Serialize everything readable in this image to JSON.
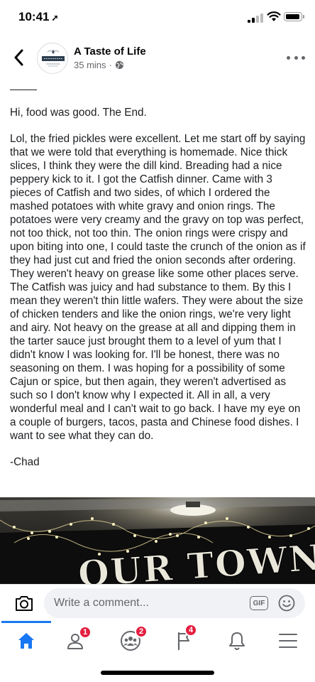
{
  "status_bar": {
    "time": "10:41",
    "location_arrow": "➚"
  },
  "header": {
    "page_name": "A Taste of Life",
    "timestamp": "35 mins",
    "separator": "·",
    "avatar_text": "A Taste of Life"
  },
  "post": {
    "intro": "Hi, food was good. The End.",
    "review": "Lol, the fried pickles were excellent. Let me start off by saying that we were told that everything is homemade. Nice thick slices, I think they were the dill kind. Breading had a nice peppery kick to it. I got the Catfish dinner. Came with 3 pieces of Catfish and two sides, of which I ordered the mashed potatoes with white gravy and onion rings. The potatoes were very creamy and the gravy on top was perfect, not too thick, not too thin. The onion rings were crispy and upon biting into one, I could taste the crunch of the onion as if they had just cut and fried the onion seconds after ordering. They weren't heavy on grease like some other places serve. The Catfish was juicy and had substance to them. By this I mean they weren't thin little wafers. They were about the size of chicken tenders and like the onion rings, we're very light and airy. Not heavy on the grease at all and dipping them in the tarter sauce just brought them to a level of yum that I didn't know I was looking for. I'll be honest, there was no seasoning on them. I was hoping for a possibility of some Cajun or spice, but then again, they weren't advertised as such so I don't know why I expected it. All in all, a very wonderful meal and I can't wait to go back. I have my eye on a couple of burgers, tacos, pasta and Chinese food dishes. I want to see what they can do.",
    "signature": "-Chad",
    "photo_sign_text": "OUR TOWN"
  },
  "comment_bar": {
    "placeholder": "Write a comment...",
    "gif_label": "GIF"
  },
  "tab_bar": {
    "tabs": [
      {
        "name": "home",
        "icon": "home-icon",
        "badge": ""
      },
      {
        "name": "friends",
        "icon": "friends-icon",
        "badge": "1"
      },
      {
        "name": "groups",
        "icon": "groups-icon",
        "badge": "2"
      },
      {
        "name": "pages",
        "icon": "pages-icon",
        "badge": "4"
      },
      {
        "name": "notifications",
        "icon": "bell-icon",
        "badge": ""
      },
      {
        "name": "menu",
        "icon": "menu-icon",
        "badge": ""
      }
    ]
  },
  "colors": {
    "accent": "#1877f2",
    "badge": "#e41e3f",
    "secondary_text": "#65676b"
  }
}
